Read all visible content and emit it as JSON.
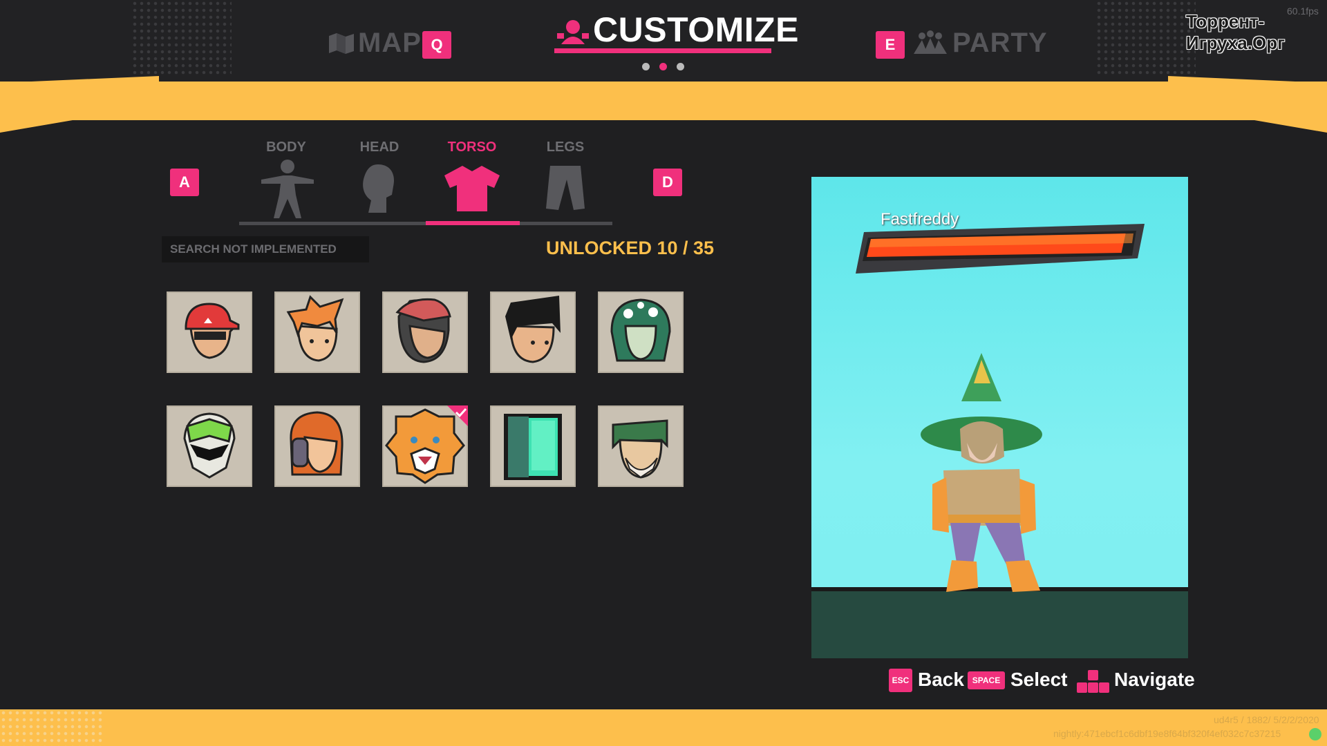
{
  "header": {
    "title": "CUSTOMIZE",
    "left_nav": {
      "label": "MAP",
      "key": "Q"
    },
    "right_nav": {
      "label": "PARTY",
      "key": "E"
    },
    "page_dots": 3,
    "active_page": 2,
    "fps": "60.1fps",
    "watermark": "Торрент-Игруха.Орг"
  },
  "tabs": {
    "prev_key": "A",
    "next_key": "D",
    "items": [
      {
        "label": "BODY",
        "icon": "body-icon"
      },
      {
        "label": "HEAD",
        "icon": "head-icon"
      },
      {
        "label": "TORSO",
        "icon": "shirt-icon",
        "active": true
      },
      {
        "label": "LEGS",
        "icon": "pants-icon"
      }
    ]
  },
  "search": {
    "placeholder": "SEARCH NOT IMPLEMENTED"
  },
  "unlocked": "UNLOCKED 10 / 35",
  "items": [
    {
      "name": "red-cap-head",
      "selected": false
    },
    {
      "name": "orange-spiky-hair-head",
      "selected": false
    },
    {
      "name": "bandana-head",
      "selected": false
    },
    {
      "name": "black-hair-head",
      "selected": false
    },
    {
      "name": "green-mushroom-hood-head",
      "selected": false
    },
    {
      "name": "green-visor-helmet",
      "selected": false
    },
    {
      "name": "headphones-head",
      "selected": false
    },
    {
      "name": "tiger-head",
      "selected": true
    },
    {
      "name": "door-costume",
      "selected": false
    },
    {
      "name": "old-man-head",
      "selected": false
    }
  ],
  "preview": {
    "player_name": "Fastfreddy",
    "health_fraction": 0.97
  },
  "footer": {
    "back": {
      "key": "ESC",
      "label": "Back"
    },
    "select": {
      "key": "SPACE",
      "label": "Select"
    },
    "navigate": {
      "label": "Navigate"
    }
  },
  "version": {
    "line1": "ud4r5 / 1882/ 5/2/2/2020",
    "line2": "nightly:471ebcf1c6dbf19e8f64bf320f4ef032c7c37215"
  },
  "colors": {
    "accent": "#f0307c",
    "band": "#fdbf4c",
    "bg": "#1f1f21"
  }
}
